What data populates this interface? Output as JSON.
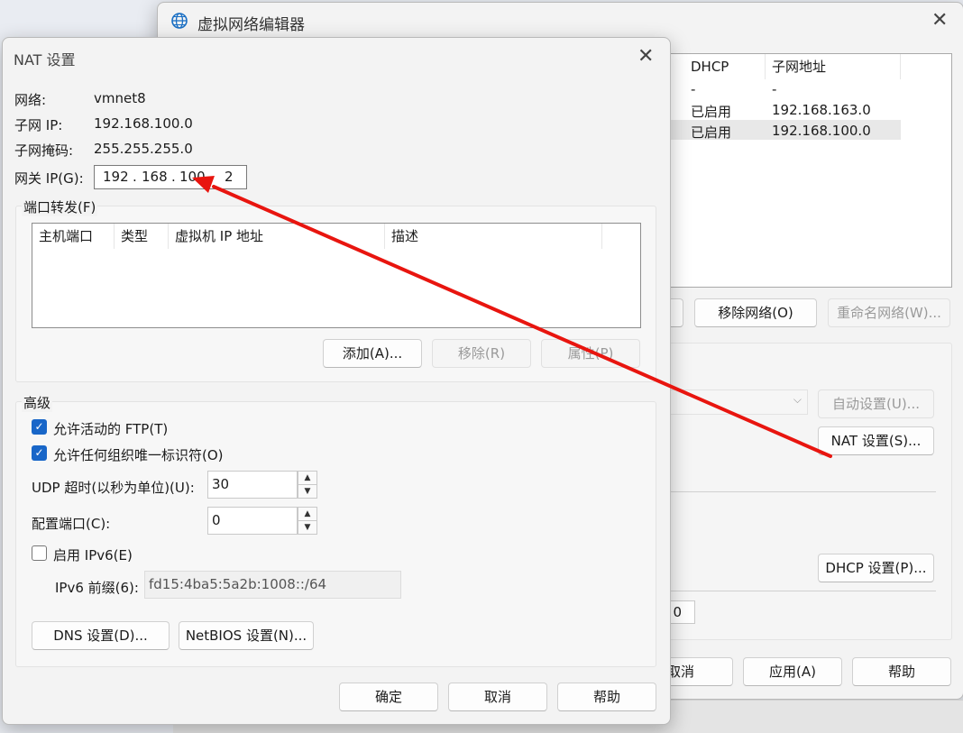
{
  "editor": {
    "title": "虚拟网络编辑器",
    "table_headers": [
      "DHCP",
      "子网地址"
    ],
    "rows": [
      {
        "dhcp": "-",
        "subnet": "-"
      },
      {
        "dhcp": "已启用",
        "subnet": "192.168.163.0"
      },
      {
        "dhcp": "已启用",
        "subnet": "192.168.100.0"
      }
    ],
    "remove_network_label": "移除网络(O)",
    "rename_network_label": "重命名网络(W)...",
    "auto_settings_label": "自动设置(U)...",
    "nat_settings_label": "NAT 设置(S)...",
    "dhcp_settings_label": "DHCP 设置(P)...",
    "partial_field_value": "0",
    "cancel_label": "取消",
    "apply_label": "应用(A)",
    "help_label": "帮助"
  },
  "nat": {
    "title": "NAT 设置",
    "network_label": "网络:",
    "network_value": "vmnet8",
    "subnet_ip_label": "子网 IP:",
    "subnet_ip_value": "192.168.100.0",
    "subnet_mask_label": "子网掩码:",
    "subnet_mask_value": "255.255.255.0",
    "gateway_label": "网关 IP(G):",
    "gateway_octets": [
      "192",
      "168",
      "100",
      "2"
    ],
    "port_forwarding": {
      "title": "端口转发(F)",
      "columns": [
        "主机端口",
        "类型",
        "虚拟机 IP 地址",
        "描述"
      ],
      "add_label": "添加(A)...",
      "remove_label": "移除(R)",
      "properties_label": "属性(P)"
    },
    "advanced": {
      "title": "高级",
      "allow_ftp_label": "允许活动的 FTP(T)",
      "allow_ftp_checked": true,
      "allow_org_uid_label": "允许任何组织唯一标识符(O)",
      "allow_org_uid_checked": true,
      "udp_timeout_label": "UDP 超时(以秒为单位)(U):",
      "udp_timeout_value": "30",
      "config_port_label": "配置端口(C):",
      "config_port_value": "0",
      "enable_ipv6_label": "启用 IPv6(E)",
      "enable_ipv6_checked": false,
      "ipv6_prefix_label": "IPv6 前缀(6):",
      "ipv6_prefix_value": "fd15:4ba5:5a2b:1008::/64",
      "dns_label": "DNS 设置(D)...",
      "netbios_label": "NetBIOS 设置(N)..."
    },
    "ok_label": "确定",
    "cancel_label": "取消",
    "help_label": "帮助"
  },
  "annotation": {
    "arrow_color": "#e8150f"
  },
  "colors": {
    "accent": "#1866c8",
    "window_bg": "#f3f3f3"
  }
}
